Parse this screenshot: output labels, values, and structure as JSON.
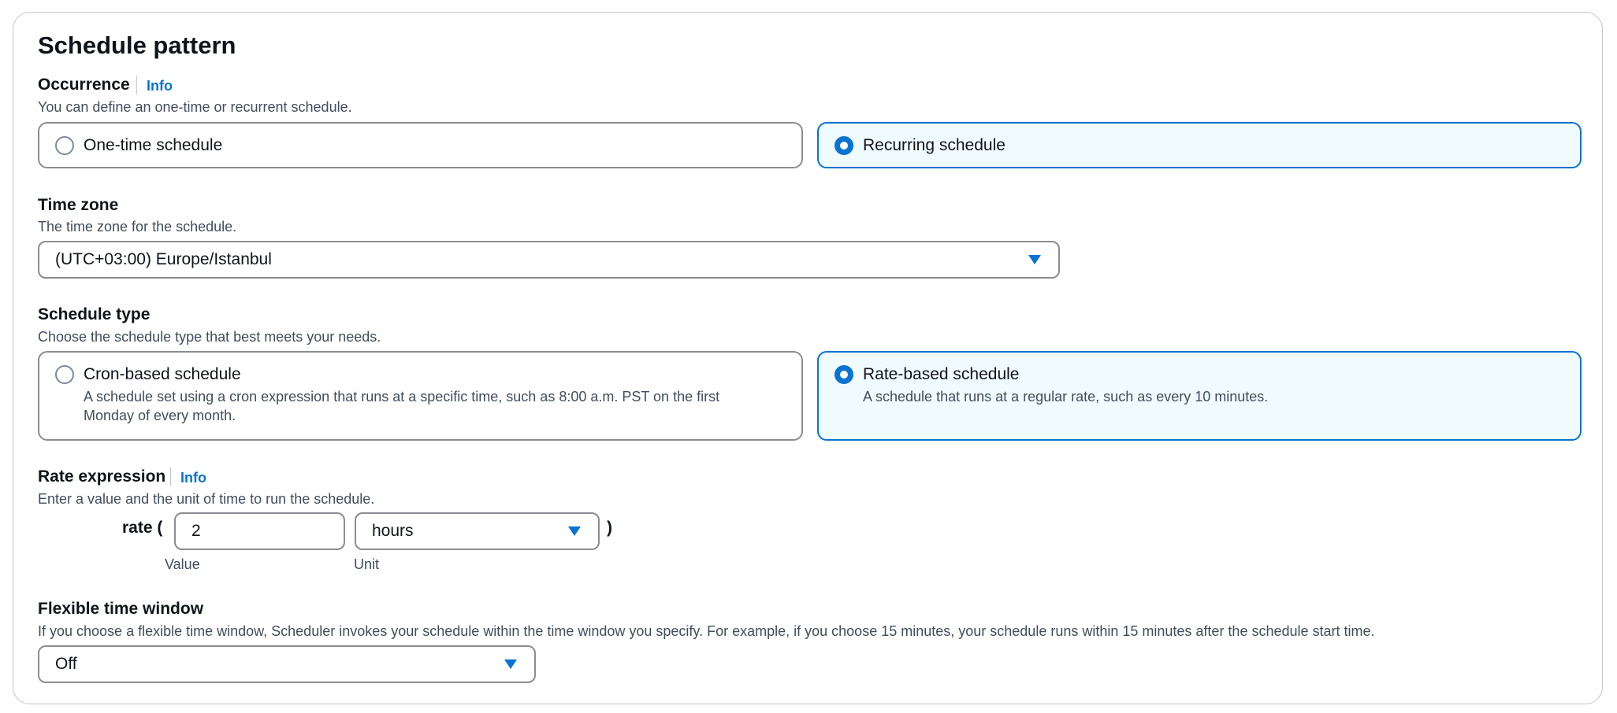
{
  "title": "Schedule pattern",
  "occurrence": {
    "label": "Occurrence",
    "info": "Info",
    "description": "You can define an one-time or recurrent schedule.",
    "options": [
      {
        "label": "One-time schedule",
        "selected": false
      },
      {
        "label": "Recurring schedule",
        "selected": true
      }
    ]
  },
  "time_zone": {
    "label": "Time zone",
    "description": "The time zone for the schedule.",
    "value": "(UTC+03:00) Europe/Istanbul"
  },
  "schedule_type": {
    "label": "Schedule type",
    "description": "Choose the schedule type that best meets your needs.",
    "options": [
      {
        "label": "Cron-based schedule",
        "description_line1": "A schedule set using a cron expression that runs at a specific time, such as 8:00 a.m. PST on the first",
        "description_line2": "Monday of every month.",
        "selected": false
      },
      {
        "label": "Rate-based schedule",
        "description_line1": "A schedule that runs at a regular rate, such as every 10 minutes.",
        "selected": true
      }
    ]
  },
  "rate_expression": {
    "label": "Rate expression",
    "info": "Info",
    "description": "Enter a value and the unit of time to run the schedule.",
    "prefix": "rate (",
    "suffix": ")",
    "value": "2",
    "value_label": "Value",
    "unit": "hours",
    "unit_label": "Unit"
  },
  "flexible_window": {
    "label": "Flexible time window",
    "description": "If you choose a flexible time window, Scheduler invokes your schedule within the time window you specify. For example, if you choose 15 minutes, your schedule runs within 15 minutes after the schedule start time.",
    "value": "Off"
  },
  "colors": {
    "accent": "#0972d3",
    "selected_bg": "#f0fbff",
    "border": "#8c8c94"
  }
}
